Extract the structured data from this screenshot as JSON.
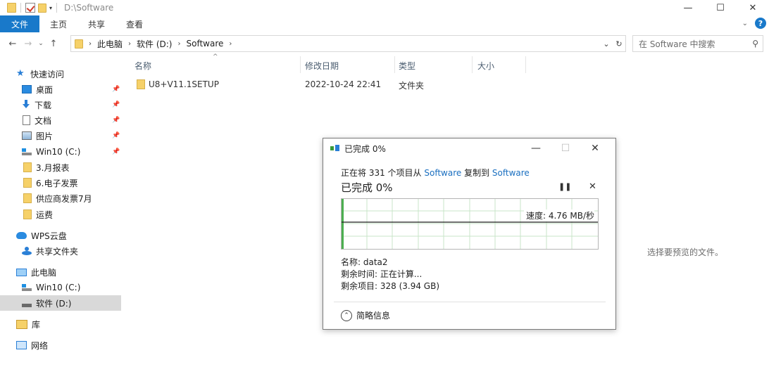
{
  "window": {
    "path_title": "D:\\Software",
    "minimize": "—",
    "maximize": "☐",
    "close": "✕"
  },
  "ribbon": {
    "tabs": [
      "文件",
      "主页",
      "共享",
      "查看"
    ]
  },
  "address": {
    "crumbs": [
      "此电脑",
      "软件 (D:)",
      "Software"
    ],
    "search_placeholder": "在 Software 中搜索"
  },
  "sidebar": {
    "items": [
      {
        "label": "快速访问",
        "icon": "star-icon"
      },
      {
        "label": "桌面",
        "icon": "desktop-icon",
        "pinned": true
      },
      {
        "label": "下载",
        "icon": "download-icon",
        "pinned": true
      },
      {
        "label": "文档",
        "icon": "document-icon",
        "pinned": true
      },
      {
        "label": "图片",
        "icon": "picture-icon",
        "pinned": true
      },
      {
        "label": "Win10 (C:)",
        "icon": "drive-icon",
        "pinned": true
      },
      {
        "label": "3.月报表",
        "icon": "folder-icon"
      },
      {
        "label": "6.电子发票",
        "icon": "folder-icon"
      },
      {
        "label": "供应商发票7月",
        "icon": "folder-icon"
      },
      {
        "label": "运费",
        "icon": "folder-icon"
      },
      {
        "label": "WPS云盘",
        "icon": "cloud-icon"
      },
      {
        "label": "共享文件夹",
        "icon": "share-icon"
      },
      {
        "label": "此电脑",
        "icon": "computer-icon"
      },
      {
        "label": "Win10 (C:)",
        "icon": "drive-icon"
      },
      {
        "label": "软件 (D:)",
        "icon": "hdd-icon",
        "selected": true
      },
      {
        "label": "库",
        "icon": "library-icon"
      },
      {
        "label": "网络",
        "icon": "network-icon"
      }
    ]
  },
  "filelist": {
    "columns": [
      "名称",
      "修改日期",
      "类型",
      "大小"
    ],
    "rows": [
      {
        "name": "U8+V11.1SETUP",
        "modified": "2022-10-24 22:41",
        "type": "文件夹",
        "size": ""
      }
    ],
    "preview_text": "选择要预览的文件。"
  },
  "copy_dialog": {
    "title": "已完成 0%",
    "desc_prefix": "正在将 331 个项目从 ",
    "source": "Software",
    "desc_middle": " 复制到 ",
    "destination": "Software",
    "status": "已完成 0%",
    "progress_percent": 0,
    "speed": "速度: 4.76 MB/秒",
    "name_line": "名称: data2",
    "time_line": "剩余时间: 正在计算...",
    "items_line": "剩余项目: 328 (3.94 GB)",
    "less_info": "简略信息"
  },
  "colors": {
    "accent": "#1979ca",
    "link": "#1a6fc0",
    "graph_grid": "#c8e6c8",
    "graph_fill": "#4caf50"
  }
}
